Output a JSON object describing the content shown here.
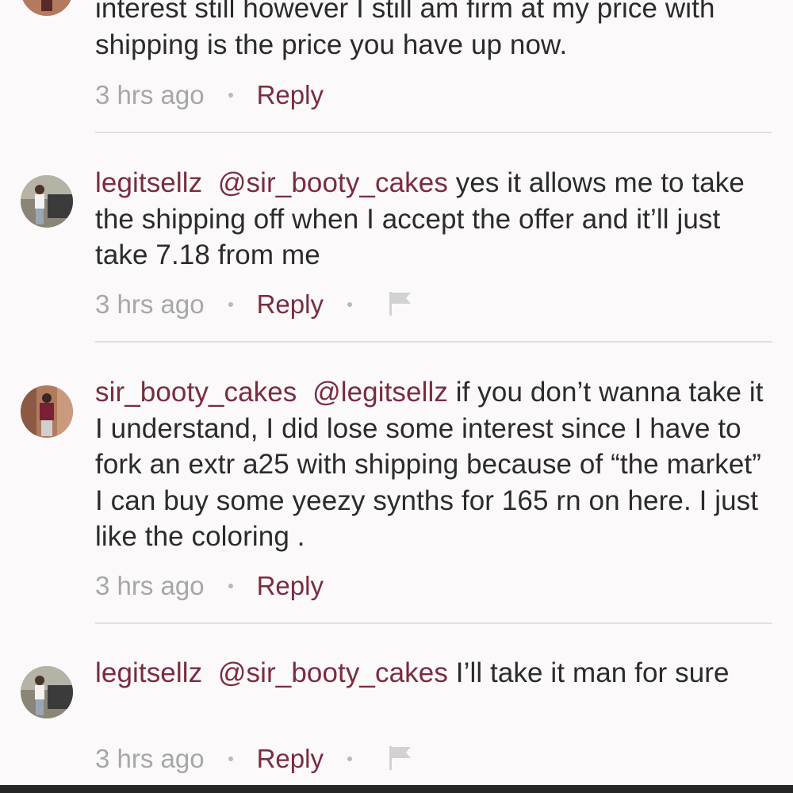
{
  "comments": [
    {
      "text": "interest still however I still am firm at my price with shipping is the price you have up now.",
      "time": "3 hrs ago",
      "reply_label": "Reply"
    },
    {
      "username": "legitsellz",
      "mention": "@sir_booty_cakes",
      "text": "yes it allows me to take the shipping off when I accept the offer and it’ll just take 7.18 from me",
      "time": "3 hrs ago",
      "reply_label": "Reply",
      "flag_icon": "flag-icon"
    },
    {
      "username": "sir_booty_cakes",
      "mention": "@legitsellz",
      "text": "if you don’t wanna take it I understand, I did lose some interest since I have to fork an extr a25 with shipping because of “the market” I can buy some yeezy synths for 165 rn on here. I just like the coloring .",
      "time": "3 hrs ago",
      "reply_label": "Reply"
    },
    {
      "username": "legitsellz",
      "mention": "@sir_booty_cakes",
      "text": "I’ll take it man for sure",
      "time": "3 hrs ago",
      "reply_label": "Reply",
      "flag_icon": "flag-icon"
    }
  ],
  "colors": {
    "accent": "#7a2c3f",
    "text": "#2b2b2b",
    "muted": "#a7a7a7",
    "background": "#fbf9fa"
  }
}
